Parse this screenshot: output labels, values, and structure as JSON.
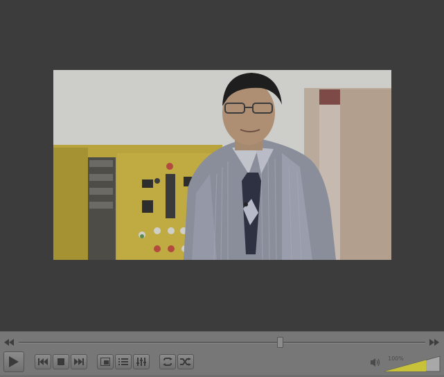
{
  "player": {
    "volume": {
      "level_text": "100%",
      "level": 1.0
    },
    "seek": {
      "position": 0.643
    },
    "icons": {
      "seek_back": "rewind-icon",
      "seek_forward": "fast-forward-icon",
      "play": "play-icon",
      "previous": "skip-previous-icon",
      "stop": "stop-icon",
      "next": "skip-next-icon",
      "fullscreen": "fullscreen-icon",
      "playlist": "playlist-icon",
      "extended_settings": "equalizer-icon",
      "loop": "loop-icon",
      "shuffle": "shuffle-icon",
      "volume": "speaker-icon"
    },
    "colors": {
      "background": "#3c3c3c",
      "controls": "#777777",
      "volume_fill": "#c7c23a"
    }
  }
}
